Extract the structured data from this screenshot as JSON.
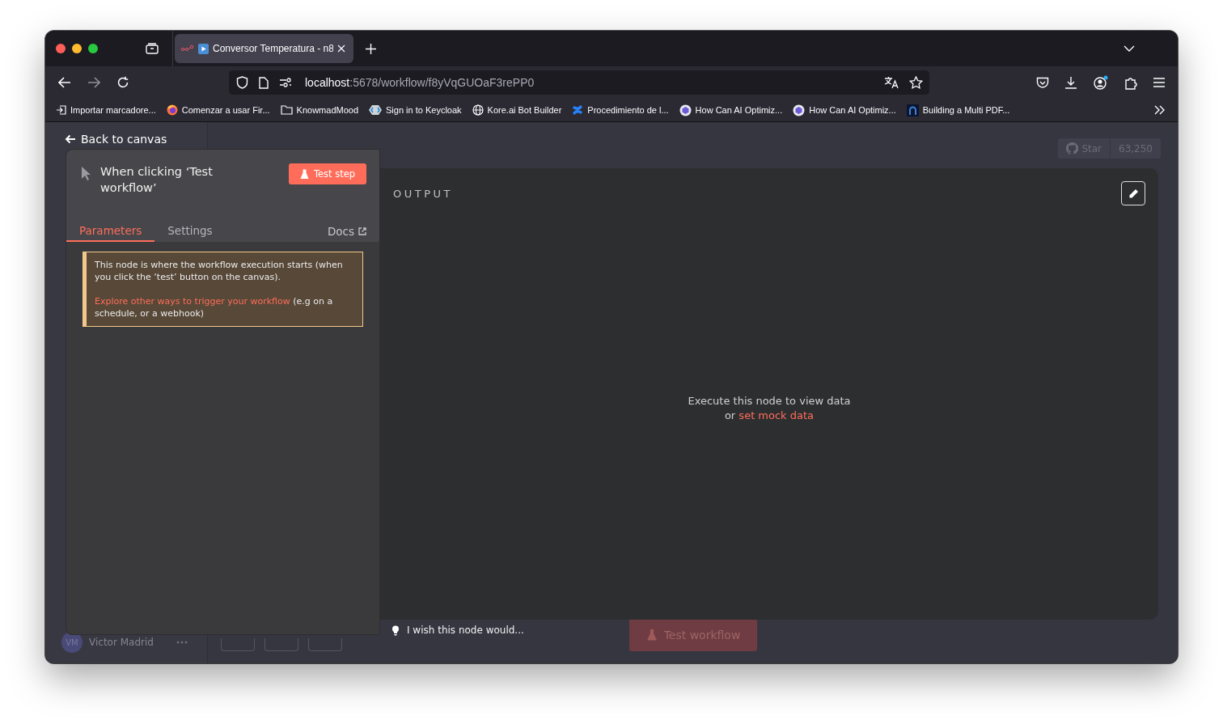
{
  "browser": {
    "tabs": [
      {
        "title": "Conversor Temperatura - n8",
        "selected": true
      }
    ],
    "url": {
      "host": "localhost",
      "path": ":5678/workflow/f8yVqGUOaF3rePP0"
    },
    "bookmarks": [
      {
        "kind": "import",
        "label": "Importar marcadore..."
      },
      {
        "kind": "firefox",
        "label": "Comenzar a usar Fir..."
      },
      {
        "kind": "folder",
        "label": "KnowmadMood"
      },
      {
        "kind": "keycloak",
        "label": "Sign in to Keycloak"
      },
      {
        "kind": "globe",
        "label": "Kore.ai Bot Builder"
      },
      {
        "kind": "confluence",
        "label": "Procedimiento de l..."
      },
      {
        "kind": "hexagon",
        "label": "How Can AI Optimiz..."
      },
      {
        "kind": "hexagon",
        "label": "How Can AI Optimiz..."
      },
      {
        "kind": "dark",
        "label": "Building a Multi PDF..."
      }
    ]
  },
  "app": {
    "user": {
      "initials": "VM",
      "name": "Victor Madrid"
    },
    "github": {
      "label": "Star",
      "count": "63,250"
    },
    "test_workflow": "Test workflow"
  },
  "node_view": {
    "back": "Back to canvas",
    "title": "When clicking ‘Test workflow’",
    "test_step": "Test step",
    "tabs": [
      {
        "label": "Parameters",
        "selected": true
      },
      {
        "label": "Settings",
        "selected": false
      }
    ],
    "docs": "Docs",
    "notice": {
      "text": "This node is where the workflow execution starts (when you click the ‘test’ button on the canvas).",
      "link": "Explore other ways to trigger your workflow",
      "text_after": " (e.g on a schedule, or a webhook)"
    },
    "output": {
      "title": "OUTPUT",
      "message": "Execute this node to view data",
      "or": "or",
      "link": "set mock data"
    },
    "feedback": "I wish this node would..."
  }
}
